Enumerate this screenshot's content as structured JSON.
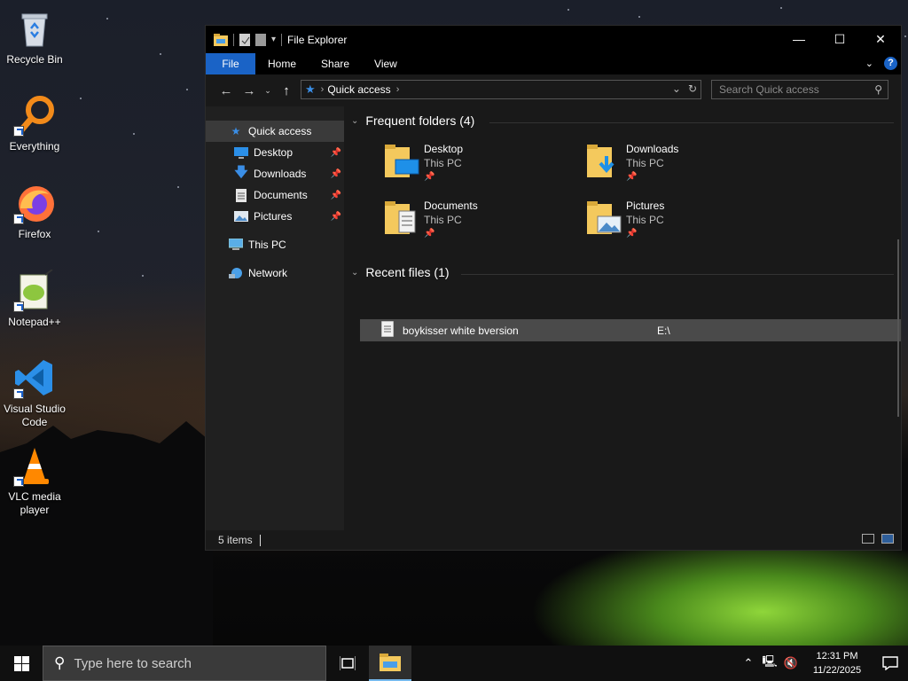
{
  "desktop": {
    "icons": [
      {
        "label": "Recycle Bin"
      },
      {
        "label": "Everything"
      },
      {
        "label": "Firefox"
      },
      {
        "label": "Notepad++"
      },
      {
        "label": "Visual Studio Code"
      },
      {
        "label": "VLC media player"
      }
    ]
  },
  "explorer": {
    "title": "File Explorer",
    "ribbon_tabs": [
      "File",
      "Home",
      "Share",
      "View"
    ],
    "address": {
      "crumb": "Quick access"
    },
    "search": {
      "placeholder": "Search Quick access"
    },
    "sidebar": {
      "items": [
        {
          "label": "Quick access",
          "icon": "star-icon",
          "pinned": false
        },
        {
          "label": "Desktop",
          "icon": "desktop-icon",
          "pinned": true
        },
        {
          "label": "Downloads",
          "icon": "download-icon",
          "pinned": true
        },
        {
          "label": "Documents",
          "icon": "documents-icon",
          "pinned": true
        },
        {
          "label": "Pictures",
          "icon": "pictures-icon",
          "pinned": true
        },
        {
          "label": "This PC",
          "icon": "computer-icon",
          "pinned": false
        },
        {
          "label": "Network",
          "icon": "network-icon",
          "pinned": false
        }
      ]
    },
    "frequent": {
      "heading": "Frequent folders (4)",
      "folders": [
        {
          "name": "Desktop",
          "location": "This PC"
        },
        {
          "name": "Downloads",
          "location": "This PC"
        },
        {
          "name": "Documents",
          "location": "This PC"
        },
        {
          "name": "Pictures",
          "location": "This PC"
        }
      ]
    },
    "recent": {
      "heading": "Recent files (1)",
      "files": [
        {
          "name": "boykisser white bversion",
          "location": "E:\\"
        }
      ]
    },
    "status": {
      "items": "5 items"
    }
  },
  "taskbar": {
    "search_placeholder": "Type here to search",
    "time": "12:31 PM",
    "date": "11/22/2025"
  },
  "colors": {
    "accent": "#1a63c6",
    "window_bg": "#191919",
    "sidebar_bg": "#202020",
    "selection": "#4a4a4a",
    "folder_yellow": "#f4c95d"
  }
}
